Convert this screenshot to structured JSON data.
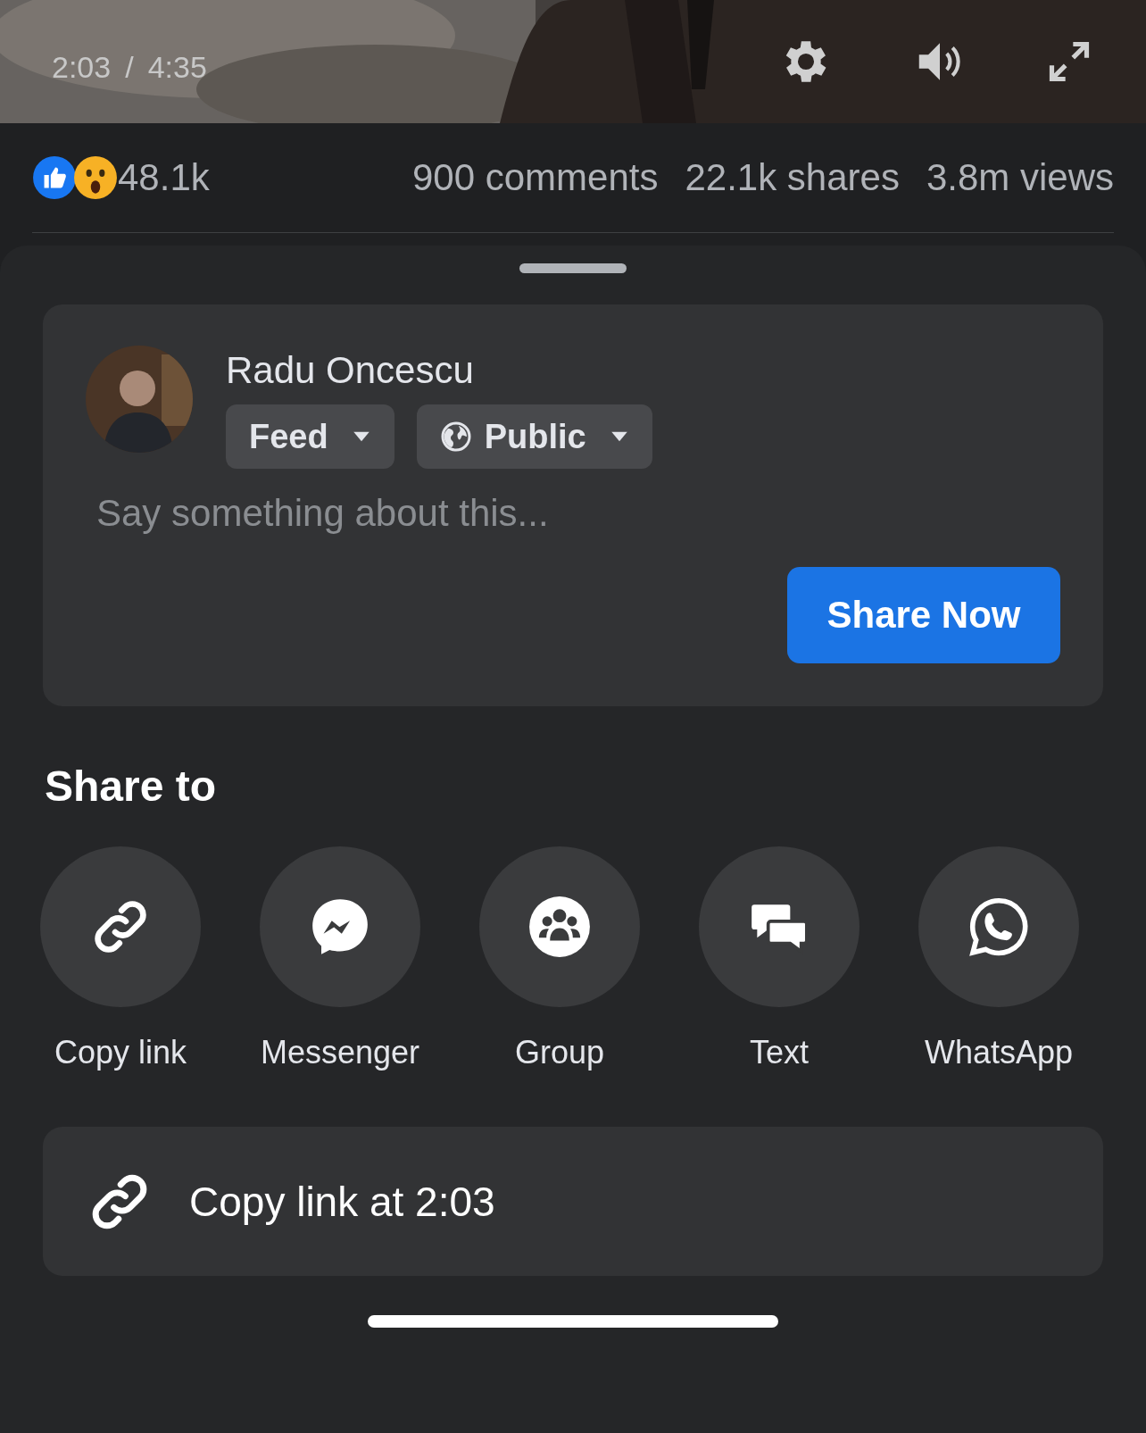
{
  "video": {
    "current_time": "2:03",
    "separator": "/",
    "duration": "4:35"
  },
  "stats": {
    "reaction_count": "48.1k",
    "comments": "900 comments",
    "shares": "22.1k shares",
    "views": "3.8m views"
  },
  "composer": {
    "user_name": "Radu Oncescu",
    "audience_buttons": [
      {
        "label": "Feed",
        "kind": "plain"
      },
      {
        "label": "Public",
        "kind": "globe"
      }
    ],
    "placeholder": "Say something about this...",
    "share_button": "Share Now"
  },
  "share_to": {
    "title": "Share to",
    "targets": [
      {
        "label": "Copy link",
        "kind": "link"
      },
      {
        "label": "Messenger",
        "kind": "messenger"
      },
      {
        "label": "Group",
        "kind": "group"
      },
      {
        "label": "Text",
        "kind": "chat"
      },
      {
        "label": "WhatsApp",
        "kind": "whatsapp"
      }
    ]
  },
  "copy_link_at": "Copy link at 2:03"
}
